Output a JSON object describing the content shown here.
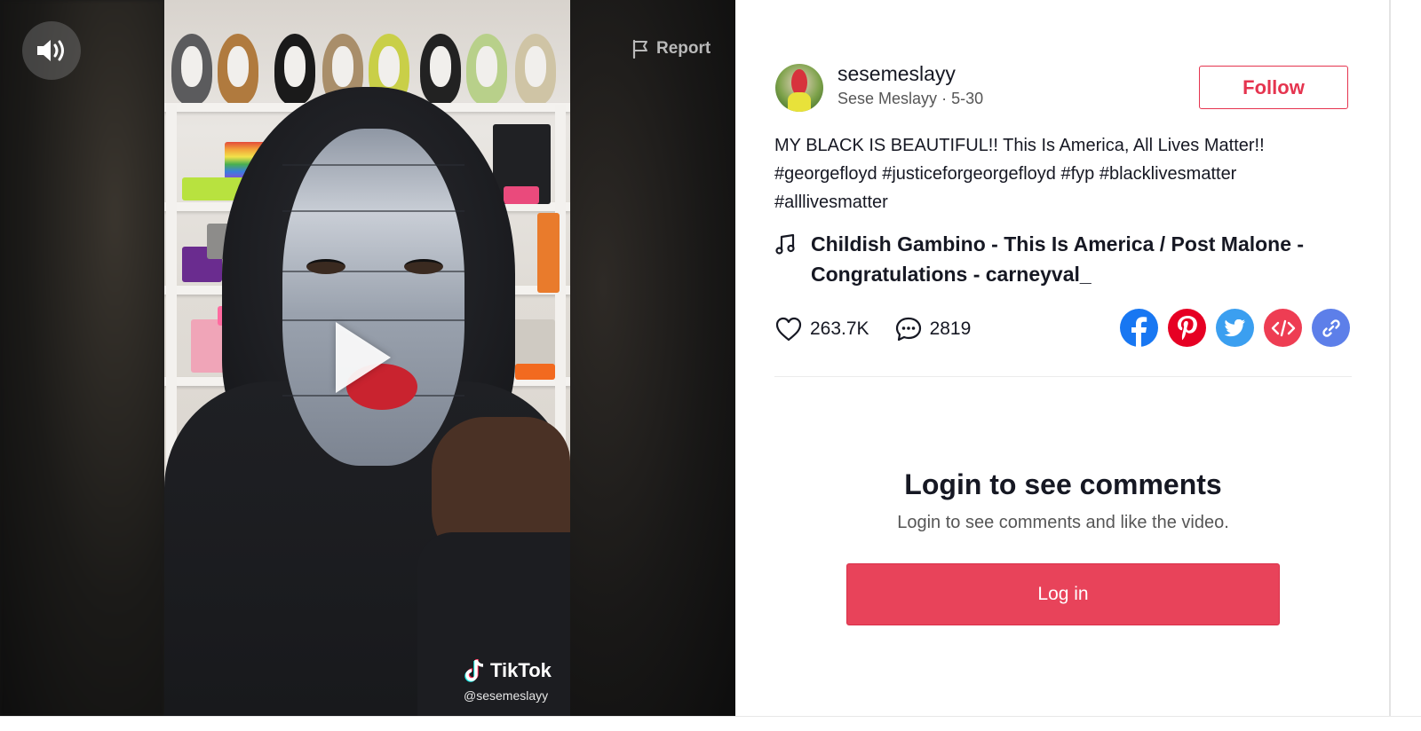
{
  "video": {
    "report_label": "Report",
    "watermark_brand": "TikTok",
    "watermark_handle": "@sesemeslayy"
  },
  "post": {
    "username": "sesemeslayy",
    "display_name": "Sese Meslayy",
    "date": "5-30",
    "follow_label": "Follow",
    "caption_text": "MY BLACK IS BEAUTIFUL!! This Is America, All Lives Matter!!",
    "hashtags": [
      "#georgefloyd",
      "#justiceforgeorgefloyd",
      "#fyp",
      "#blacklivesmatter",
      "#alllivesmatter"
    ],
    "music": "Childish Gambino - This Is America / Post Malone - Congratulations - carneyval_",
    "likes": "263.7K",
    "comments": "2819"
  },
  "share": {
    "colors": {
      "facebook": "#1877f2",
      "pinterest": "#e60023",
      "twitter": "#3b9ff0",
      "embed": "#ee3d53",
      "link": "#5d7fe9"
    },
    "icons": [
      "facebook-icon",
      "pinterest-icon",
      "twitter-icon",
      "embed-icon",
      "link-icon"
    ]
  },
  "login": {
    "title": "Login to see comments",
    "subtitle": "Login to see comments and like the video.",
    "button_label": "Log in"
  },
  "colors": {
    "accent": "#e8435a",
    "follow_border": "#e5344f"
  }
}
